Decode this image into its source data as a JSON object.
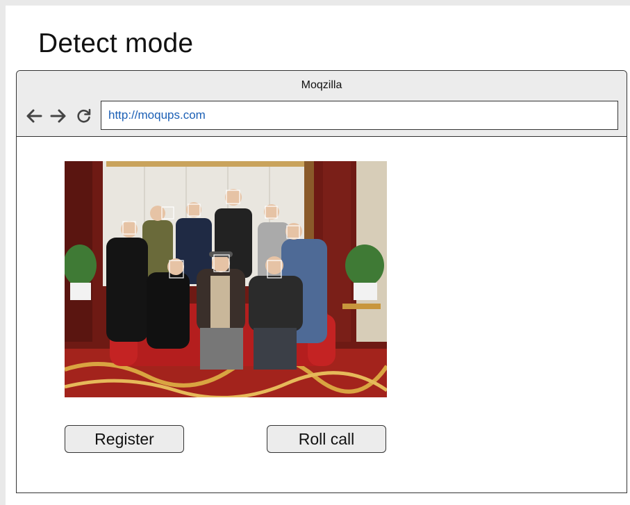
{
  "page": {
    "title": "Detect mode"
  },
  "browser": {
    "window_title": "Moqzilla",
    "url": "http://moqups.com",
    "nav": {
      "back_icon": "arrow-left-icon",
      "forward_icon": "arrow-right-icon",
      "reload_icon": "reload-icon"
    }
  },
  "content": {
    "photo": {
      "description_icon": "group-photo-with-face-detection-boxes",
      "detected_faces": 9
    },
    "buttons": {
      "register_label": "Register",
      "rollcall_label": "Roll call"
    }
  },
  "colors": {
    "url_text": "#1b5fb5",
    "chrome_bg": "#ececec",
    "button_bg": "#ececec",
    "border": "#333333"
  }
}
